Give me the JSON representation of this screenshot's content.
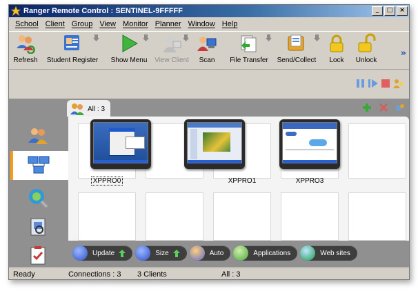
{
  "window": {
    "title": "Ranger Remote Control : SENTINEL-9FFFFF",
    "controls": [
      "_",
      "□",
      "×"
    ]
  },
  "menu": [
    "School",
    "Client",
    "Group",
    "View",
    "Monitor",
    "Planner",
    "Window",
    "Help"
  ],
  "toolbar": {
    "refresh": "Refresh",
    "student_register": "Student Register",
    "show_menu": "Show Menu",
    "view_client": "View Client",
    "scan": "Scan",
    "file_transfer": "File Transfer",
    "send_collect": "Send/Collect",
    "lock": "Lock",
    "unlock": "Unlock",
    "more": "»"
  },
  "group_tab": {
    "label": "All : 3"
  },
  "clients": [
    {
      "name": "XPPRO0"
    },
    {
      "name": "XPPRO1"
    },
    {
      "name": "XPPRO3"
    }
  ],
  "bottom_buttons": {
    "update": "Update",
    "size": "Size",
    "auto": "Auto",
    "applications": "Applications",
    "web_sites": "Web sites"
  },
  "status": {
    "ready": "Ready",
    "connections": "Connections : 3",
    "clients": "3 Clients",
    "all": "All : 3"
  },
  "colors": {
    "title_start": "#0a246a",
    "title_end": "#a6caf0",
    "accent_orange": "#f59d1a",
    "panel_gray": "#909090"
  }
}
